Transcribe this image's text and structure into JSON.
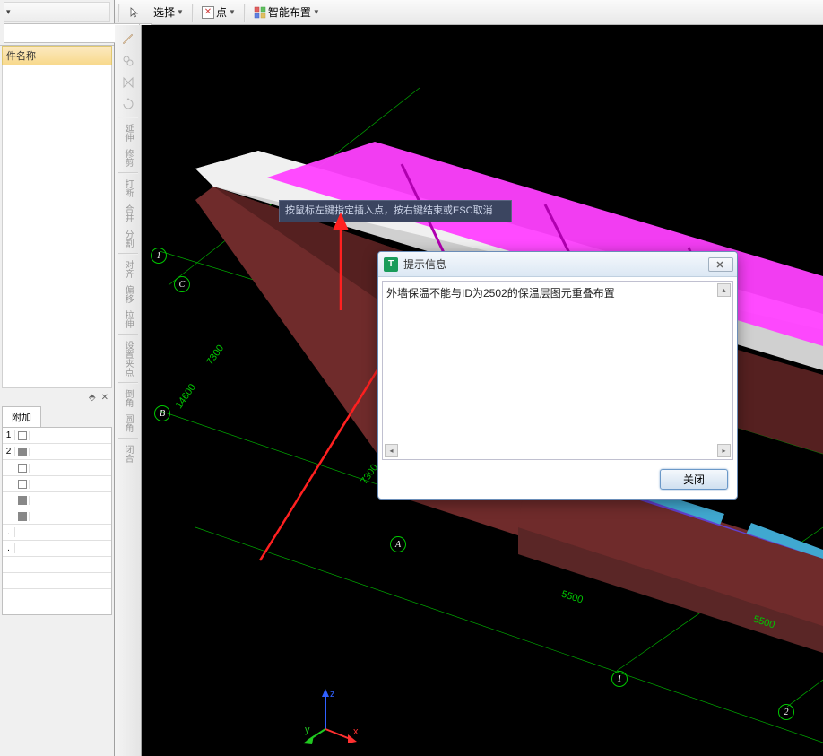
{
  "toolbar": {
    "select_label": "选择",
    "point_label": "点",
    "smart_label": "智能布置"
  },
  "left_panel": {
    "search_placeholder": "",
    "header_label": "件名称",
    "tab_attach": "附加",
    "pin_symbol": "⬘",
    "close_symbol": "✕"
  },
  "vert_tools": {
    "t_extend": "延伸",
    "t_trim": "修剪",
    "t_break": "打断",
    "t_merge": "合并",
    "t_split": "分割",
    "t_align": "对齐",
    "t_offset": "偏移",
    "t_stretch": "拉伸",
    "t_grip": "设置夹点",
    "t_chamfer": "倒角",
    "t_fillet": "圆角",
    "t_close": "闭合"
  },
  "hint": {
    "text": "按鼠标左键指定插入点，按右键结束或ESC取消"
  },
  "dialog": {
    "title": "提示信息",
    "message": "外墙保温不能与ID为2502的保温层图元重叠布置",
    "close_btn": "关闭",
    "icon_letter": "T"
  },
  "dims": {
    "d7300_a": "7300",
    "d14600": "14600",
    "d7300_b": "7300",
    "d5500_a": "5500",
    "d5500_b": "5500"
  },
  "grid_labels": {
    "g1": "1",
    "gC": "C",
    "gB": "B",
    "gA": "A",
    "n1": "1",
    "n2": "2"
  },
  "axes": {
    "x": "x",
    "y": "y",
    "z": "z"
  }
}
